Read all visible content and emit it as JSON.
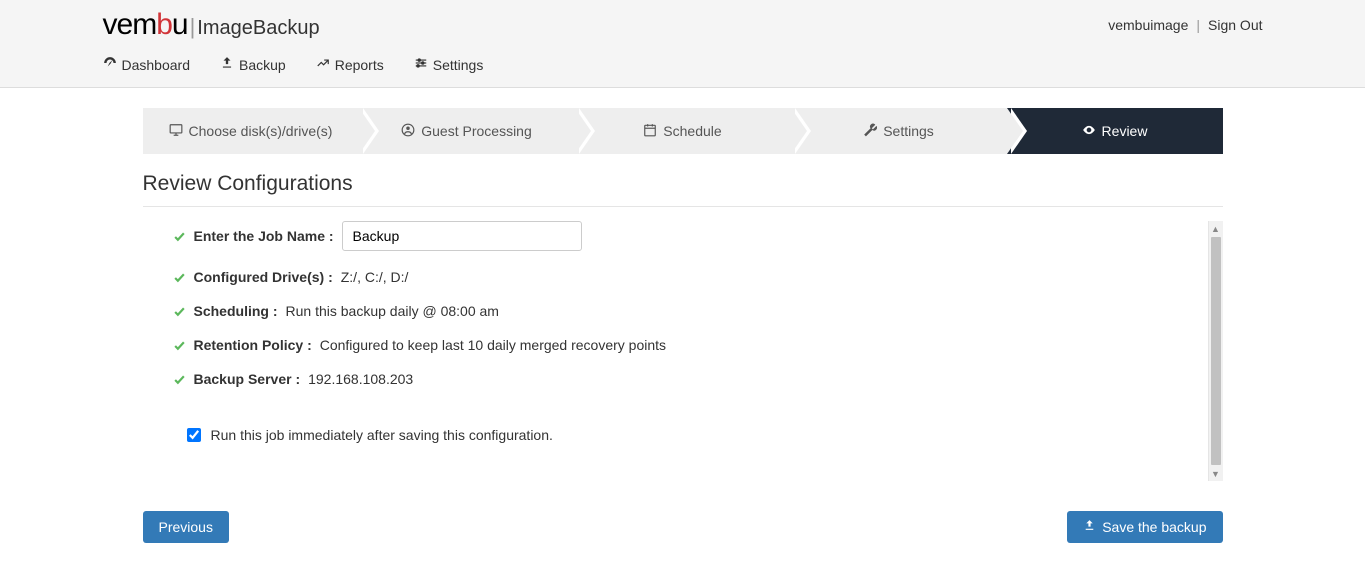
{
  "brand": {
    "logo_text": "vembu",
    "product": "ImageBackup"
  },
  "user": {
    "name": "vembuimage",
    "signout": "Sign Out"
  },
  "nav": {
    "dashboard": "Dashboard",
    "backup": "Backup",
    "reports": "Reports",
    "settings": "Settings"
  },
  "wizard": {
    "step1": "Choose disk(s)/drive(s)",
    "step2": "Guest Processing",
    "step3": "Schedule",
    "step4": "Settings",
    "step5": "Review"
  },
  "heading": "Review Configurations",
  "review": {
    "jobname_label": "Enter the Job Name :",
    "jobname_value": "Backup",
    "drives_label": "Configured Drive(s) :",
    "drives_value": "Z:/, C:/, D:/",
    "scheduling_label": "Scheduling :",
    "scheduling_value": "Run this backup daily @ 08:00 am",
    "retention_label": "Retention Policy :",
    "retention_value": "Configured to keep last 10 daily merged recovery points",
    "server_label": "Backup Server :",
    "server_value": "192.168.108.203",
    "run_immediately": "Run this job immediately after saving this configuration.",
    "run_immediately_checked": true
  },
  "buttons": {
    "previous": "Previous",
    "save": "Save the backup"
  }
}
